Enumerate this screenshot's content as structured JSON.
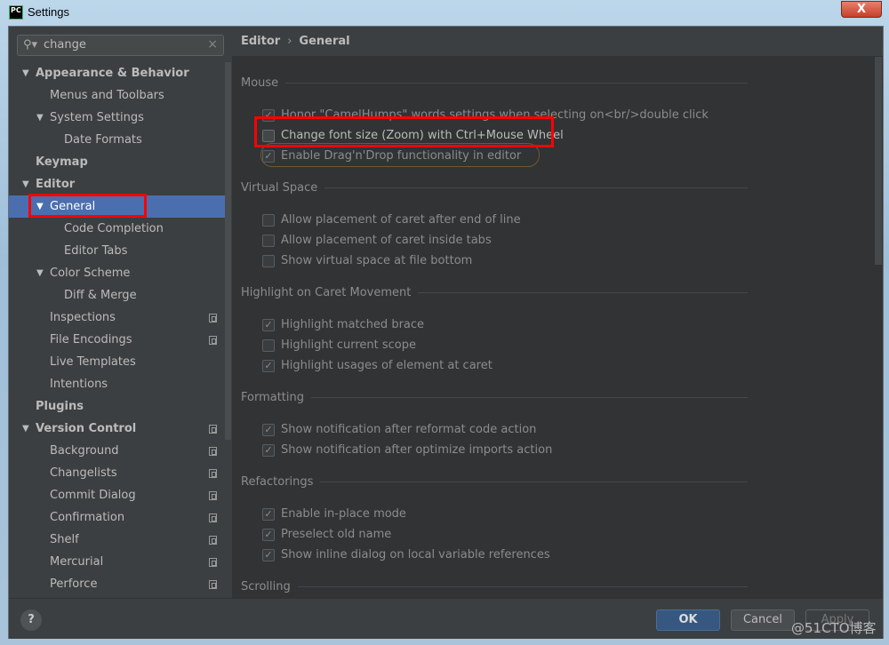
{
  "window": {
    "title": "Settings",
    "close_label": "X",
    "app_icon": "PC"
  },
  "search": {
    "value": "change"
  },
  "sidebar": {
    "items": [
      {
        "label": "Appearance & Behavior",
        "level": 0,
        "bold": true,
        "arrow": "▼"
      },
      {
        "label": "Menus and Toolbars",
        "level": 1
      },
      {
        "label": "System Settings",
        "level": 1,
        "arrow": "▼"
      },
      {
        "label": "Date Formats",
        "level": 2
      },
      {
        "label": "Keymap",
        "level": 0,
        "bold": true
      },
      {
        "label": "Editor",
        "level": 0,
        "bold": true,
        "arrow": "▼"
      },
      {
        "label": "General",
        "level": 1,
        "arrow": "▼",
        "selected": true
      },
      {
        "label": "Code Completion",
        "level": 2
      },
      {
        "label": "Editor Tabs",
        "level": 2
      },
      {
        "label": "Color Scheme",
        "level": 1,
        "arrow": "▼"
      },
      {
        "label": "Diff & Merge",
        "level": 2
      },
      {
        "label": "Inspections",
        "level": 1,
        "copy": true
      },
      {
        "label": "File Encodings",
        "level": 1,
        "copy": true
      },
      {
        "label": "Live Templates",
        "level": 1
      },
      {
        "label": "Intentions",
        "level": 1
      },
      {
        "label": "Plugins",
        "level": 0,
        "bold": true
      },
      {
        "label": "Version Control",
        "level": 0,
        "bold": true,
        "arrow": "▼",
        "copy": true
      },
      {
        "label": "Background",
        "level": 1,
        "copy": true
      },
      {
        "label": "Changelists",
        "level": 1,
        "copy": true
      },
      {
        "label": "Commit Dialog",
        "level": 1,
        "copy": true
      },
      {
        "label": "Confirmation",
        "level": 1,
        "copy": true
      },
      {
        "label": "Shelf",
        "level": 1,
        "copy": true
      },
      {
        "label": "Mercurial",
        "level": 1,
        "copy": true
      },
      {
        "label": "Perforce",
        "level": 1,
        "copy": true
      }
    ]
  },
  "breadcrumb": {
    "parent": "Editor",
    "separator": "›",
    "current": "General"
  },
  "sections": [
    {
      "title": "Mouse",
      "options": [
        {
          "label": "Honor \"CamelHumps\" words settings when selecting on<br/>double click",
          "checked": true,
          "enabled": false
        },
        {
          "label": "Change font size (Zoom) with Ctrl+Mouse Wheel",
          "checked": false,
          "enabled": true
        },
        {
          "label": "Enable Drag'n'Drop functionality in editor",
          "checked": true,
          "enabled": false
        }
      ]
    },
    {
      "title": "Virtual Space",
      "options": [
        {
          "label": "Allow placement of caret after end of line",
          "checked": false,
          "enabled": false
        },
        {
          "label": "Allow placement of caret inside tabs",
          "checked": false,
          "enabled": false
        },
        {
          "label": "Show virtual space at file bottom",
          "checked": false,
          "enabled": false
        }
      ]
    },
    {
      "title": "Highlight on Caret Movement",
      "options": [
        {
          "label": "Highlight matched brace",
          "checked": true,
          "enabled": false
        },
        {
          "label": "Highlight current scope",
          "checked": false,
          "enabled": false
        },
        {
          "label": "Highlight usages of element at caret",
          "checked": true,
          "enabled": false
        }
      ]
    },
    {
      "title": "Formatting",
      "options": [
        {
          "label": "Show notification after reformat code action",
          "checked": true,
          "enabled": false
        },
        {
          "label": "Show notification after optimize imports action",
          "checked": true,
          "enabled": false
        }
      ]
    },
    {
      "title": "Refactorings",
      "options": [
        {
          "label": "Enable in-place mode",
          "checked": true,
          "enabled": false
        },
        {
          "label": "Preselect old name",
          "checked": true,
          "enabled": false
        },
        {
          "label": "Show inline dialog on local variable references",
          "checked": true,
          "enabled": false
        }
      ]
    },
    {
      "title": "Scrolling",
      "options": []
    }
  ],
  "footer": {
    "help": "?",
    "ok": "OK",
    "cancel": "Cancel",
    "apply": "Apply"
  },
  "watermark": "@51CTO博客",
  "colors": {
    "selection": "#4b6eaf",
    "highlight_box": "#ff0000",
    "ok_button": "#365880"
  }
}
